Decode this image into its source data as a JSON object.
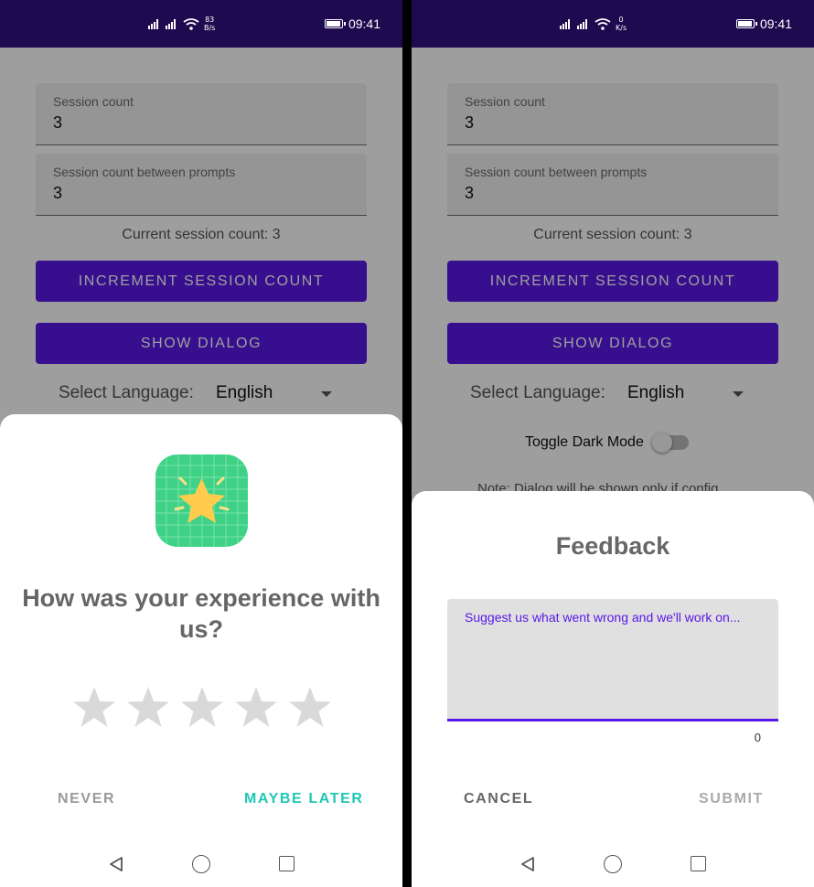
{
  "screens": [
    {
      "status": {
        "speed_value": "83",
        "speed_unit": "B/s",
        "time": "09:41"
      },
      "session_count_label": "Session count",
      "session_count_value": "3",
      "between_prompts_label": "Session count between prompts",
      "between_prompts_value": "3",
      "current_session_text": "Current session count: 3",
      "increment_button": "INCREMENT SESSION COUNT",
      "show_dialog_button": "SHOW DIALOG",
      "language_label": "Select Language:",
      "language_value": "English",
      "dialog": {
        "title": "How was your experience with us?",
        "rating": 0,
        "star_count": 5,
        "never_button": "NEVER",
        "maybe_later_button": "MAYBE LATER"
      }
    },
    {
      "status": {
        "speed_value": "0",
        "speed_unit": "K/s",
        "time": "09:41"
      },
      "session_count_label": "Session count",
      "session_count_value": "3",
      "between_prompts_label": "Session count between prompts",
      "between_prompts_value": "3",
      "current_session_text": "Current session count: 3",
      "increment_button": "INCREMENT SESSION COUNT",
      "show_dialog_button": "SHOW DIALOG",
      "language_label": "Select Language:",
      "language_value": "English",
      "toggle_label": "Toggle Dark Mode",
      "toggle_on": false,
      "note_text": "Note: Dialog will be shown only if config",
      "dialog": {
        "title": "Feedback",
        "placeholder": "Suggest us what went wrong and we'll work on...",
        "char_count": "0",
        "cancel_button": "CANCEL",
        "submit_button": "SUBMIT"
      }
    }
  ],
  "colors": {
    "primary": "#5a19e6",
    "status_bar": "#1e0a4f",
    "accent_teal": "#1ec8b4",
    "star_empty": "#d9d9d9",
    "app_icon_bg": "#3fd286",
    "star_icon_fill": "#ffcc4d"
  },
  "icons": {
    "app_icon": "star-grid-app-icon",
    "nav_back": "triangle-back-icon",
    "nav_home": "circle-home-icon",
    "nav_recent": "square-recents-icon"
  }
}
